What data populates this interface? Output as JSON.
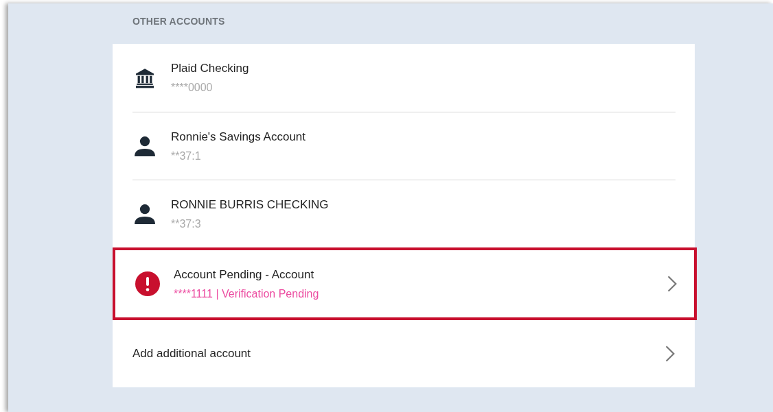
{
  "section_title": "OTHER ACCOUNTS",
  "accounts": [
    {
      "kind": "bank",
      "name": "Plaid Checking",
      "detail": "****0000",
      "pending": false,
      "highlighted": false,
      "chevron": false
    },
    {
      "kind": "person",
      "name": "Ronnie's Savings Account",
      "detail": "**37:1",
      "pending": false,
      "highlighted": false,
      "chevron": false
    },
    {
      "kind": "person",
      "name": "RONNIE BURRIS CHECKING",
      "detail": "**37:3",
      "pending": false,
      "highlighted": false,
      "chevron": false
    },
    {
      "kind": "alert",
      "name": "Account Pending - Account",
      "detail": "****1111 | Verification Pending",
      "pending": true,
      "highlighted": true,
      "chevron": true
    }
  ],
  "add_account": {
    "label": "Add additional account",
    "chevron": true
  }
}
